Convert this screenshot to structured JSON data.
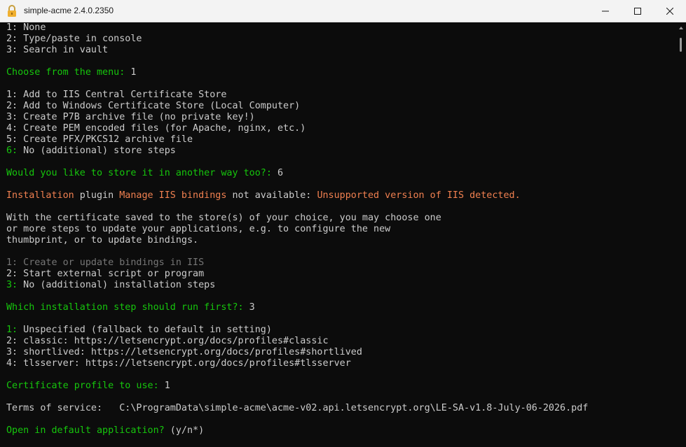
{
  "window": {
    "title": "simple-acme 2.4.0.2350",
    "icon": "lock-icon"
  },
  "console": {
    "l01": "1: None",
    "l02": "2: Type/paste in console",
    "l03": "3: Search in vault",
    "l05_prompt": "Choose from the menu: ",
    "l05_answer": "1",
    "l07": "1: Add to IIS Central Certificate Store",
    "l08": "2: Add to Windows Certificate Store (Local Computer)",
    "l09": "3: Create P7B archive file (no private key!)",
    "l10": "4: Create PEM encoded files (for Apache, nginx, etc.)",
    "l11": "5: Create PFX/PKCS12 archive file",
    "l12_num": "6:",
    "l12_text": " No (additional) store steps",
    "l14_prompt": "Would you like to store it in another way too?: ",
    "l14_answer": "6",
    "l16_a": "Installation",
    "l16_b": " plugin ",
    "l16_c": "Manage IIS bindings",
    "l16_d": " not available: ",
    "l16_e": "Unsupported version of IIS detected.",
    "l18": "With the certificate saved to the store(s) of your choice, you may choose one",
    "l19": "or more steps to update your applications, e.g. to configure the new",
    "l20": "thumbprint, or to update bindings.",
    "l22": "1: Create or update bindings in IIS",
    "l23": "2: Start external script or program",
    "l24_num": "3:",
    "l24_text": " No (additional) installation steps",
    "l26_prompt": "Which installation step should run first?: ",
    "l26_answer": "3",
    "l28_num": "1:",
    "l28_text": " Unspecified (fallback to default in setting)",
    "l29": "2: classic: https://letsencrypt.org/docs/profiles#classic",
    "l30": "3: shortlived: https://letsencrypt.org/docs/profiles#shortlived",
    "l31": "4: tlsserver: https://letsencrypt.org/docs/profiles#tlsserver",
    "l33_prompt": "Certificate profile to use: ",
    "l33_answer": "1",
    "l35": "Terms of service:   C:\\ProgramData\\simple-acme\\acme-v02.api.letsencrypt.org\\LE-SA-v1.8-July-06-2026.pdf",
    "l37_prompt": "Open in default application? ",
    "l37_answer": "(y/n*)"
  },
  "colors": {
    "prompt_green": "#16c60c",
    "warning_orange": "#f08050",
    "disabled_gray": "#767676",
    "text": "#cccccc",
    "background": "#0c0c0c"
  }
}
